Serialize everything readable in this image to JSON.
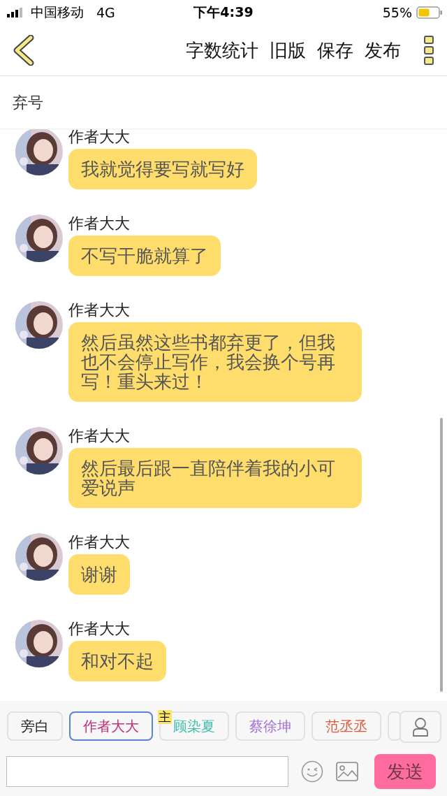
{
  "status_bar": {
    "carrier": "中国移动",
    "network": "4G",
    "time": "下午4:39",
    "battery": "55%"
  },
  "nav": {
    "actions": [
      "字数统计",
      "旧版",
      "保存",
      "发布"
    ]
  },
  "title": "弃号",
  "messages": [
    {
      "sender": "作者大大",
      "text": "我就觉得要写就写好"
    },
    {
      "sender": "作者大大",
      "text": "不写干脆就算了"
    },
    {
      "sender": "作者大大",
      "text": "然后虽然这些书都弃更了，但我也不会停止写作，我会换个号再写！重头来过！"
    },
    {
      "sender": "作者大大",
      "text": "然后最后跟一直陪伴着我的小可爱说声"
    },
    {
      "sender": "作者大大",
      "text": "谢谢"
    },
    {
      "sender": "作者大大",
      "text": "和对不起"
    }
  ],
  "characters": [
    {
      "name": "旁白",
      "color": "#222222",
      "selected": false
    },
    {
      "name": "作者大大",
      "color": "#c0307a",
      "selected": true
    },
    {
      "name": "顾染夏",
      "color": "#3cbfae",
      "selected": false,
      "badge": "主"
    },
    {
      "name": "蔡徐坤",
      "color": "#a36fd4",
      "selected": false
    },
    {
      "name": "范丞丞",
      "color": "#de5a3c",
      "selected": false
    }
  ],
  "composer": {
    "send": "发送"
  }
}
